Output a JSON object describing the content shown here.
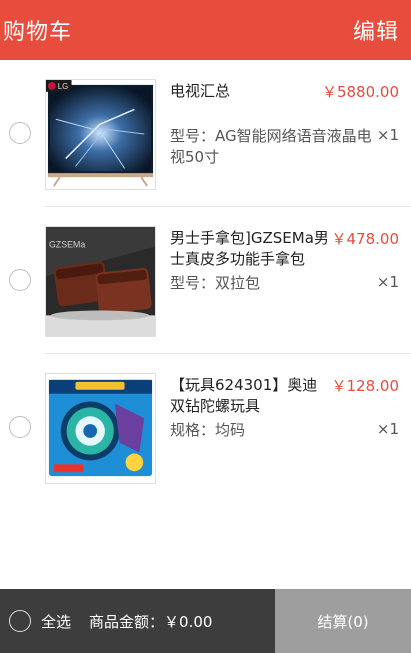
{
  "header": {
    "title": "购物车",
    "edit_label": "编辑"
  },
  "items": [
    {
      "name": "电视汇总",
      "price": "￥5880.00",
      "spec": "型号：AG智能网络语音液晶电视50寸",
      "qty": "×1",
      "thumb_brand": "LG",
      "thumb_icon": "television-image"
    },
    {
      "name": "男士手拿包]GZSEMa男士真皮多功能手拿包",
      "price": "￥478.00",
      "spec": "型号：双拉包",
      "qty": "×1",
      "thumb_brand": "GZSEMa",
      "thumb_icon": "leather-wallet-image"
    },
    {
      "name": "【玩具624301】奥迪双钻陀螺玩具",
      "price": "￥128.00",
      "spec": "规格：均码",
      "qty": "×1",
      "thumb_icon": "spinning-top-toy-image"
    }
  ],
  "footer": {
    "select_all_label": "全选",
    "amount_label": "商品金额：",
    "amount_value": "￥0.00",
    "checkout_label": "结算(0)"
  },
  "colors": {
    "accent": "#e74c3c",
    "footer_bg": "#3d3d3d",
    "checkout_bg": "#9e9e9e"
  }
}
